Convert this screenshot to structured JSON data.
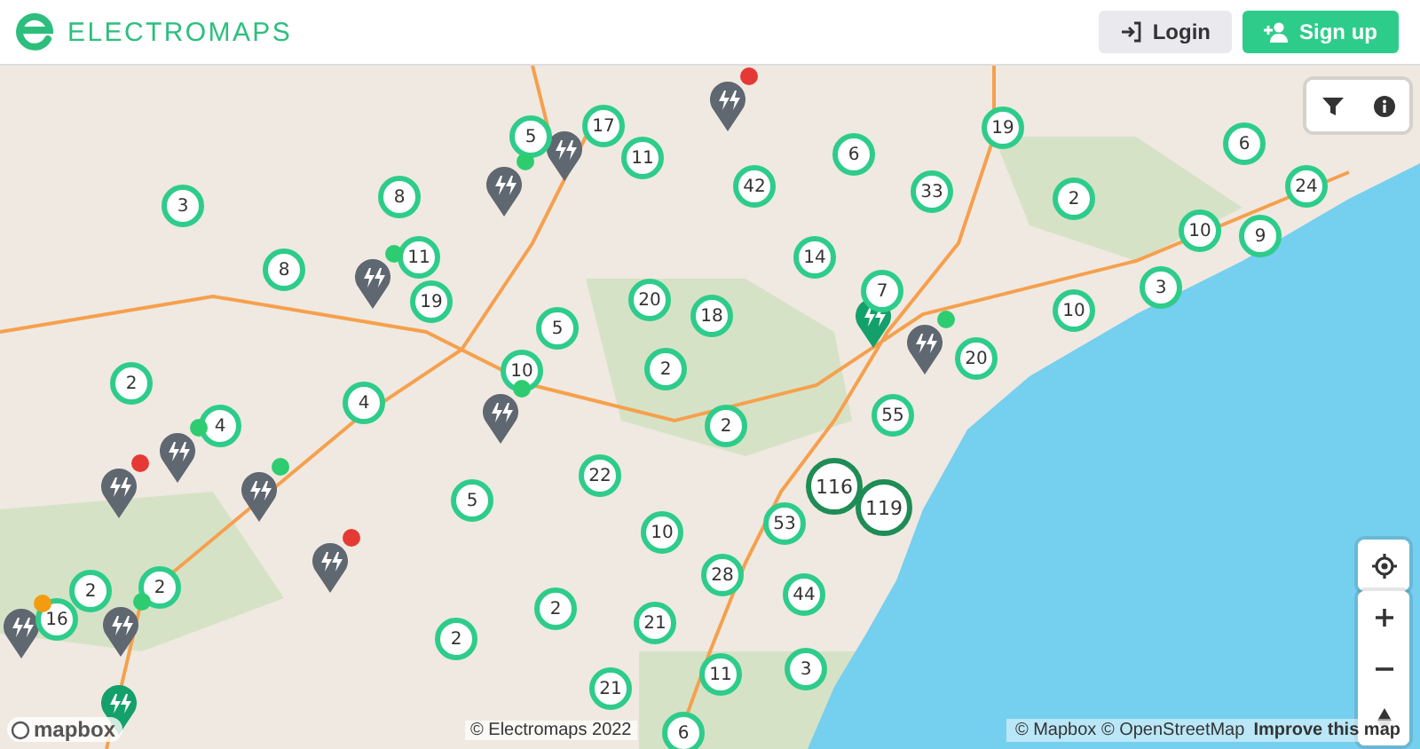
{
  "header": {
    "brand": "ELECTROMAPS",
    "buttons": [
      {
        "kind": "login",
        "label": "Login"
      },
      {
        "kind": "signup",
        "label": "Sign up"
      }
    ]
  },
  "map": {
    "clusters": [
      {
        "count": "5",
        "large": false
      },
      {
        "count": "17",
        "large": false
      },
      {
        "count": "11",
        "large": false
      },
      {
        "count": "19",
        "large": false
      },
      {
        "count": "6",
        "large": false
      },
      {
        "count": "42",
        "large": false
      },
      {
        "count": "33",
        "large": false
      },
      {
        "count": "6",
        "large": false
      },
      {
        "count": "24",
        "large": false
      },
      {
        "count": "3",
        "large": false
      },
      {
        "count": "8",
        "large": false
      },
      {
        "count": "2",
        "large": false
      },
      {
        "count": "10",
        "large": false
      },
      {
        "count": "9",
        "large": false
      },
      {
        "count": "11",
        "large": false
      },
      {
        "count": "8",
        "large": false
      },
      {
        "count": "14",
        "large": false
      },
      {
        "count": "7",
        "large": false
      },
      {
        "count": "3",
        "large": false
      },
      {
        "count": "19",
        "large": false
      },
      {
        "count": "20",
        "large": false
      },
      {
        "count": "18",
        "large": false
      },
      {
        "count": "10",
        "large": false
      },
      {
        "count": "5",
        "large": false
      },
      {
        "count": "20",
        "large": false
      },
      {
        "count": "10",
        "large": false
      },
      {
        "count": "2",
        "large": false
      },
      {
        "count": "2",
        "large": false
      },
      {
        "count": "4",
        "large": false
      },
      {
        "count": "55",
        "large": false
      },
      {
        "count": "4",
        "large": false
      },
      {
        "count": "2",
        "large": false
      },
      {
        "count": "22",
        "large": false
      },
      {
        "count": "116",
        "large": true
      },
      {
        "count": "119",
        "large": true
      },
      {
        "count": "5",
        "large": false
      },
      {
        "count": "53",
        "large": false
      },
      {
        "count": "10",
        "large": false
      },
      {
        "count": "28",
        "large": false
      },
      {
        "count": "2",
        "large": false
      },
      {
        "count": "2",
        "large": false
      },
      {
        "count": "44",
        "large": false
      },
      {
        "count": "16",
        "large": false
      },
      {
        "count": "2",
        "large": false
      },
      {
        "count": "21",
        "large": false
      },
      {
        "count": "2",
        "large": false
      },
      {
        "count": "11",
        "large": false
      },
      {
        "count": "3",
        "large": false
      },
      {
        "count": "21",
        "large": false
      },
      {
        "count": "6",
        "large": false
      }
    ],
    "pins": [
      {
        "kind": "occupied",
        "color": "#e53935"
      },
      {
        "kind": "occupied",
        "color": "#2ecc71"
      },
      {
        "kind": "occupied"
      },
      {
        "kind": "occupied",
        "color": "#2ecc71"
      },
      {
        "kind": "occupied",
        "color": "#2ecc71"
      },
      {
        "kind": "occupied",
        "color": "#2ecc71"
      },
      {
        "kind": "occupied",
        "color": "#2ecc71"
      },
      {
        "kind": "occupied",
        "color": "#e53935"
      },
      {
        "kind": "occupied",
        "color": "#2ecc71"
      },
      {
        "kind": "occupied",
        "color": "#e53935"
      },
      {
        "kind": "occupied",
        "color": "#f39c12"
      },
      {
        "kind": "occupied",
        "color": "#2ecc71"
      },
      {
        "kind": "available"
      },
      {
        "kind": "available"
      }
    ],
    "logo": "mapbox",
    "copyright": "© Electromaps 2022",
    "attribution": "© Mapbox © OpenStreetMap",
    "improve_link": "Improve this map"
  }
}
